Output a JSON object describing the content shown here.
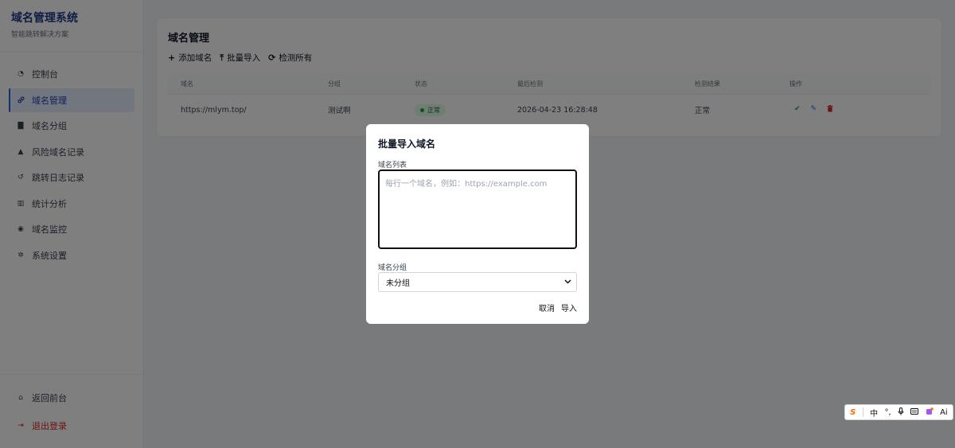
{
  "brand": {
    "title": "域名管理系统",
    "subtitle": "智能跳转解决方案"
  },
  "sidebar": {
    "items": [
      {
        "label": "控制台",
        "icon": "dashboard-icon",
        "glyph": "◔"
      },
      {
        "label": "域名管理",
        "icon": "link-icon",
        "glyph": "🔗"
      },
      {
        "label": "域名分组",
        "icon": "folder-icon",
        "glyph": "▇"
      },
      {
        "label": "风险域名记录",
        "icon": "warning-icon",
        "glyph": "▲"
      },
      {
        "label": "跳转日志记录",
        "icon": "history-icon",
        "glyph": "↺"
      },
      {
        "label": "统计分析",
        "icon": "bar-chart-icon",
        "glyph": "▥"
      },
      {
        "label": "域名监控",
        "icon": "eye-icon",
        "glyph": "◉"
      },
      {
        "label": "系统设置",
        "icon": "gear-icon",
        "glyph": "✲"
      }
    ],
    "bottom": [
      {
        "label": "返回前台",
        "icon": "home-icon",
        "glyph": "⌂"
      },
      {
        "label": "退出登录",
        "icon": "logout-icon",
        "glyph": "⇥"
      }
    ]
  },
  "main": {
    "title": "域名管理",
    "toolbar": {
      "add": "添加域名",
      "import": "批量导入",
      "check_all": "检测所有"
    },
    "table": {
      "headers": [
        "域名",
        "分组",
        "状态",
        "最后检测",
        "检测结果",
        "操作"
      ],
      "rows": [
        {
          "domain": "https://mlym.top/",
          "group": "测试啊",
          "status": "正常",
          "last_check": "2026-04-23 16:28:48",
          "result": "正常"
        }
      ]
    }
  },
  "modal": {
    "title": "批量导入域名",
    "list_label": "域名列表",
    "list_placeholder": "每行一个域名，例如：https://example.com",
    "group_label": "域名分组",
    "group_value": "未分组",
    "cancel": "取消",
    "import": "导入"
  },
  "ime": {
    "lang": "中",
    "ai": "Ai"
  },
  "colors": {
    "accent": "#2563eb",
    "brand": "#1e3a8a",
    "success": "#16a34a",
    "danger": "#dc2626"
  }
}
